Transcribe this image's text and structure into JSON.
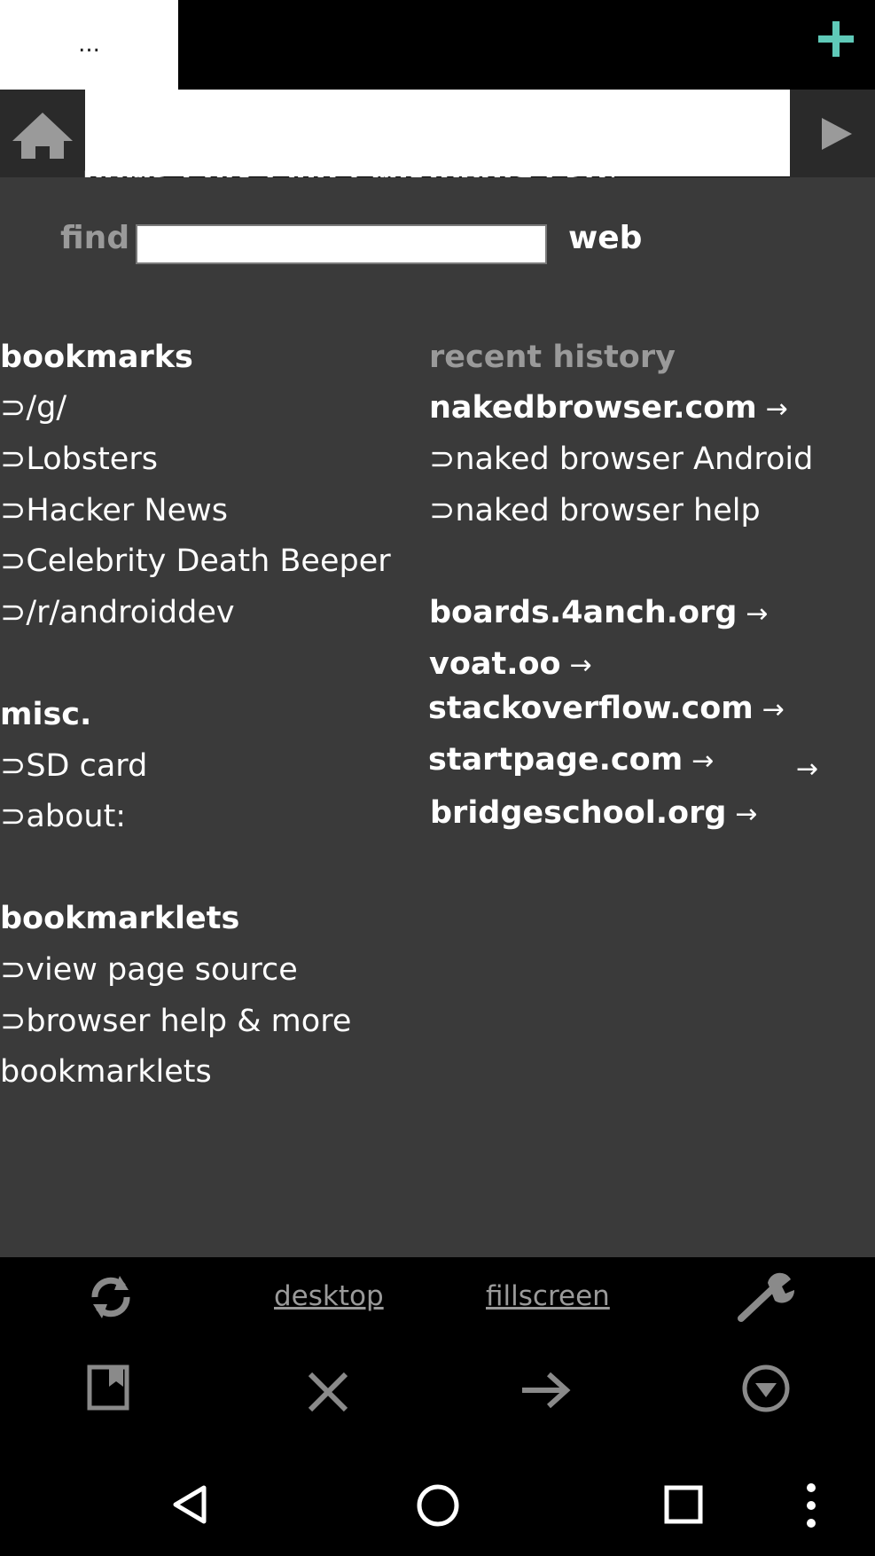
{
  "tab": {
    "title": "..."
  },
  "search": {
    "shortcuts": "news · pix · vid · wikipedia · stock",
    "find_label": "find",
    "find_value": "",
    "web_label": "web"
  },
  "bookmarks": {
    "heading": "bookmarks",
    "items": [
      "⊃/g/",
      "⊃Lobsters",
      "⊃Hacker News",
      "⊃Celebrity Death Beeper",
      "⊃/r/androiddev"
    ]
  },
  "misc": {
    "heading": "misc.",
    "items": [
      "⊃SD card",
      "⊃about:"
    ]
  },
  "bookmarklets": {
    "heading": "bookmarklets",
    "items": [
      "⊃view page source",
      "⊃browser help & more",
      "bookmarklets"
    ]
  },
  "history": {
    "heading": "recent history",
    "site1": {
      "label": "nakedbrowser.com",
      "arrow": "→"
    },
    "sub1": "⊃naked browser Android",
    "sub2": "⊃naked browser help",
    "site2": {
      "label": "boards.4anch.org",
      "arrow": "→"
    },
    "site3": {
      "label": "voat.oo",
      "arrow": "→"
    },
    "site4": {
      "label": "stackoverflow.com",
      "arrow": "→"
    },
    "site5": {
      "label": "startpage.com",
      "arrow": "→"
    },
    "extra_arrow": "→",
    "site6": {
      "label": "bridgeschool.org",
      "arrow": "→"
    }
  },
  "toolbar": {
    "desktop_label": "desktop",
    "fillscreen_label": "fillscreen"
  },
  "icons": {
    "plus": "plus-icon",
    "home": "home-icon",
    "go": "play-icon",
    "refresh": "refresh-icon",
    "wrench": "wrench-icon",
    "bookmark": "bookmark-icon",
    "close": "close-icon",
    "forward": "arrow-right-icon",
    "download": "download-icon",
    "nav_back": "back-icon",
    "nav_home": "home-circle-icon",
    "nav_recents": "recents-icon",
    "nav_menu": "more-icon"
  },
  "colors": {
    "accent": "#5fc9b8",
    "page_bg": "#3a3a3a",
    "dim_text": "#9a9a9a",
    "icon_gray": "#8a8a8a"
  }
}
